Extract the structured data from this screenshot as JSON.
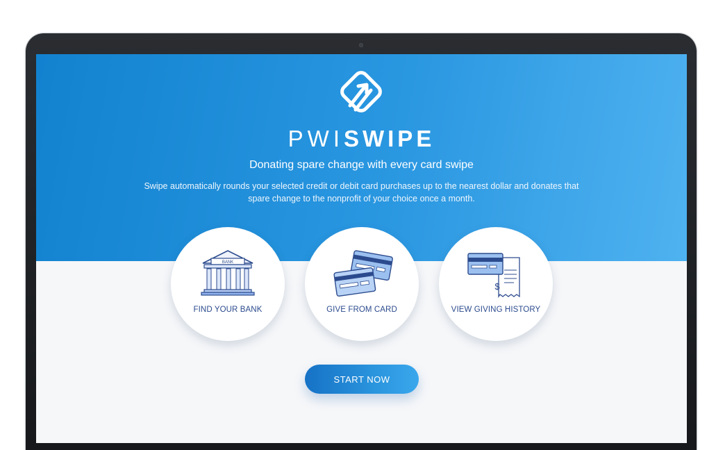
{
  "brand": {
    "name_light": "PWI",
    "name_bold": "SWIPE"
  },
  "hero": {
    "tagline": "Donating spare change with every card swipe",
    "description": "Swipe automatically rounds your selected credit or debit card purchases up to the nearest dollar and donates that spare change to the nonprofit of your choice once a month."
  },
  "features": [
    {
      "label": "FIND YOUR BANK",
      "icon": "bank-icon",
      "icon_text": "BANK"
    },
    {
      "label": "GIVE FROM CARD",
      "icon": "credit-cards-icon"
    },
    {
      "label": "VIEW GIVING HISTORY",
      "icon": "receipt-history-icon"
    }
  ],
  "cta": {
    "label": "START NOW"
  },
  "colors": {
    "accent": "#1f8ad6",
    "hero_end": "#4fb2f0",
    "label": "#2c4b8e",
    "background": "#f6f7f9"
  }
}
